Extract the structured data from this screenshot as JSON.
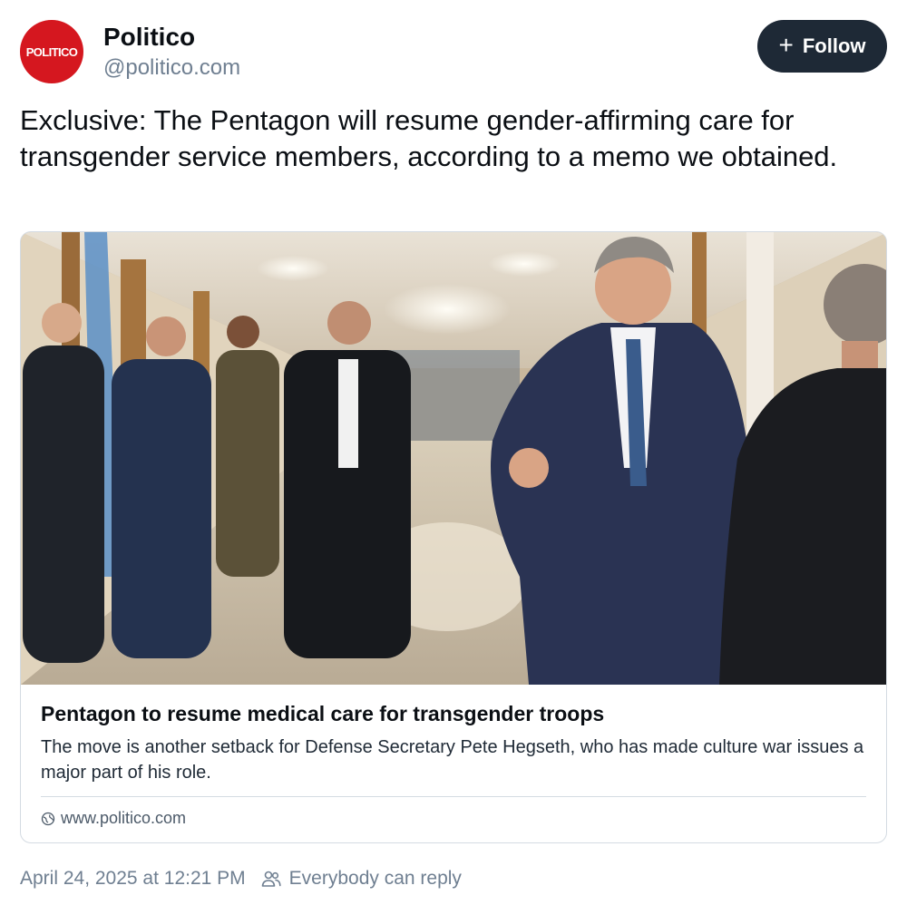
{
  "author": {
    "avatar_text": "POLITICO",
    "display_name": "Politico",
    "handle": "@politico.com"
  },
  "follow_button": {
    "label": "Follow",
    "icon": "plus-icon"
  },
  "post": {
    "text": "Exclusive: The Pentagon will resume gender-affirming care for transgender service members, according to a memo we obtained."
  },
  "link_card": {
    "image_description_icon": "photo",
    "title": "Pentagon to resume medical care for transgender troops",
    "description": "The move is another setback for Defense Secretary Pete Hegseth, who has made culture war issues a major part of his role.",
    "domain": "www.politico.com",
    "domain_icon": "globe-icon"
  },
  "footer": {
    "timestamp": "April 24, 2025 at 12:21 PM",
    "reply_setting": "Everybody can reply",
    "reply_icon": "people-icon"
  },
  "colors": {
    "brand_red": "#d5171f",
    "follow_bg": "#1e2936",
    "muted_text": "#6f7f91",
    "border": "#d4dbe2"
  }
}
